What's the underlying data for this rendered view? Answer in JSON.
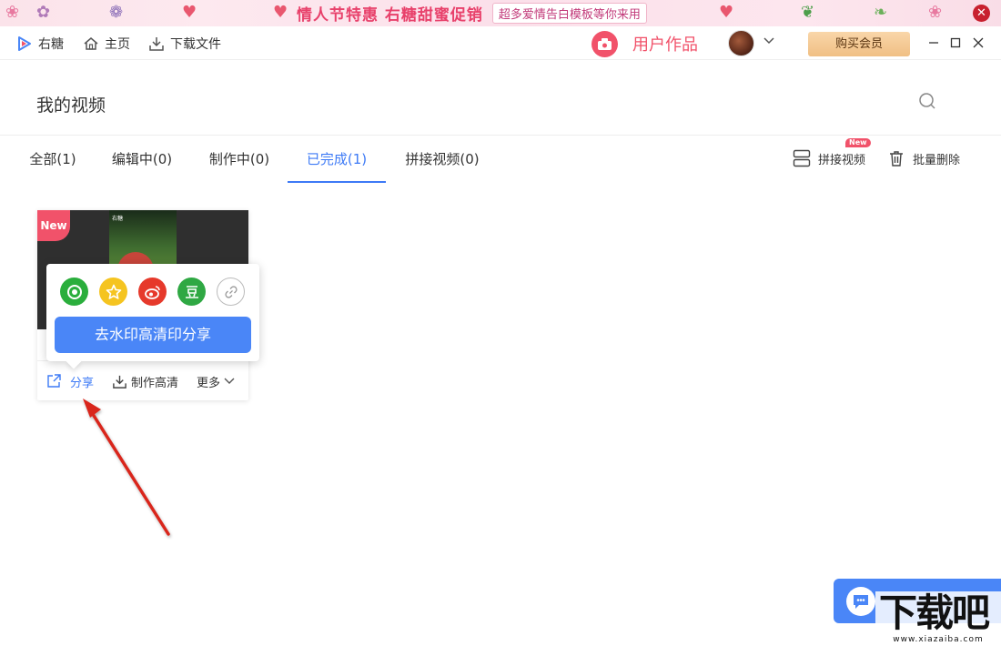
{
  "banner": {
    "title": "情人节特惠 右糖甜蜜促销",
    "subtitle": "超多爱情告白模板等你来用",
    "close_glyph": "✕"
  },
  "titlebar": {
    "app_name": "右糖",
    "home_label": "主页",
    "download_label": "下载文件",
    "user_works_label": "用户作品",
    "vip_label": "购买会员"
  },
  "header": {
    "title": "我的视频"
  },
  "tabs": [
    {
      "label": "全部(1)"
    },
    {
      "label": "编辑中(0)"
    },
    {
      "label": "制作中(0)"
    },
    {
      "label": "已完成(1)"
    },
    {
      "label": "拼接视频(0)"
    }
  ],
  "tools": {
    "merge_label": "拼接视频",
    "merge_badge": "New",
    "batch_delete_label": "批量删除"
  },
  "card": {
    "new_badge": "New",
    "thumb_logo": "右糖",
    "actions": {
      "share": "分享",
      "make_hd": "制作高清",
      "more": "更多"
    }
  },
  "share_popup": {
    "icons": [
      {
        "name": "wechat-moments-icon",
        "color": "#2aae3c",
        "glyph": "◎"
      },
      {
        "name": "qzone-icon",
        "color": "#f5c420",
        "glyph": "★"
      },
      {
        "name": "weibo-icon",
        "color": "#e6392b",
        "glyph": "◉"
      },
      {
        "name": "douban-icon",
        "color": "#2fa843",
        "glyph": "豆"
      },
      {
        "name": "link-icon",
        "color": "#ffffff",
        "glyph": "🔗"
      }
    ],
    "cta_label": "去水印高清印分享"
  },
  "watermark": {
    "text": "下载吧",
    "url": "www.xiazaiba.com"
  },
  "colors": {
    "accent": "#3d7af6",
    "brand_pink": "#f1526a",
    "vip_gold": "#f0bf84"
  }
}
